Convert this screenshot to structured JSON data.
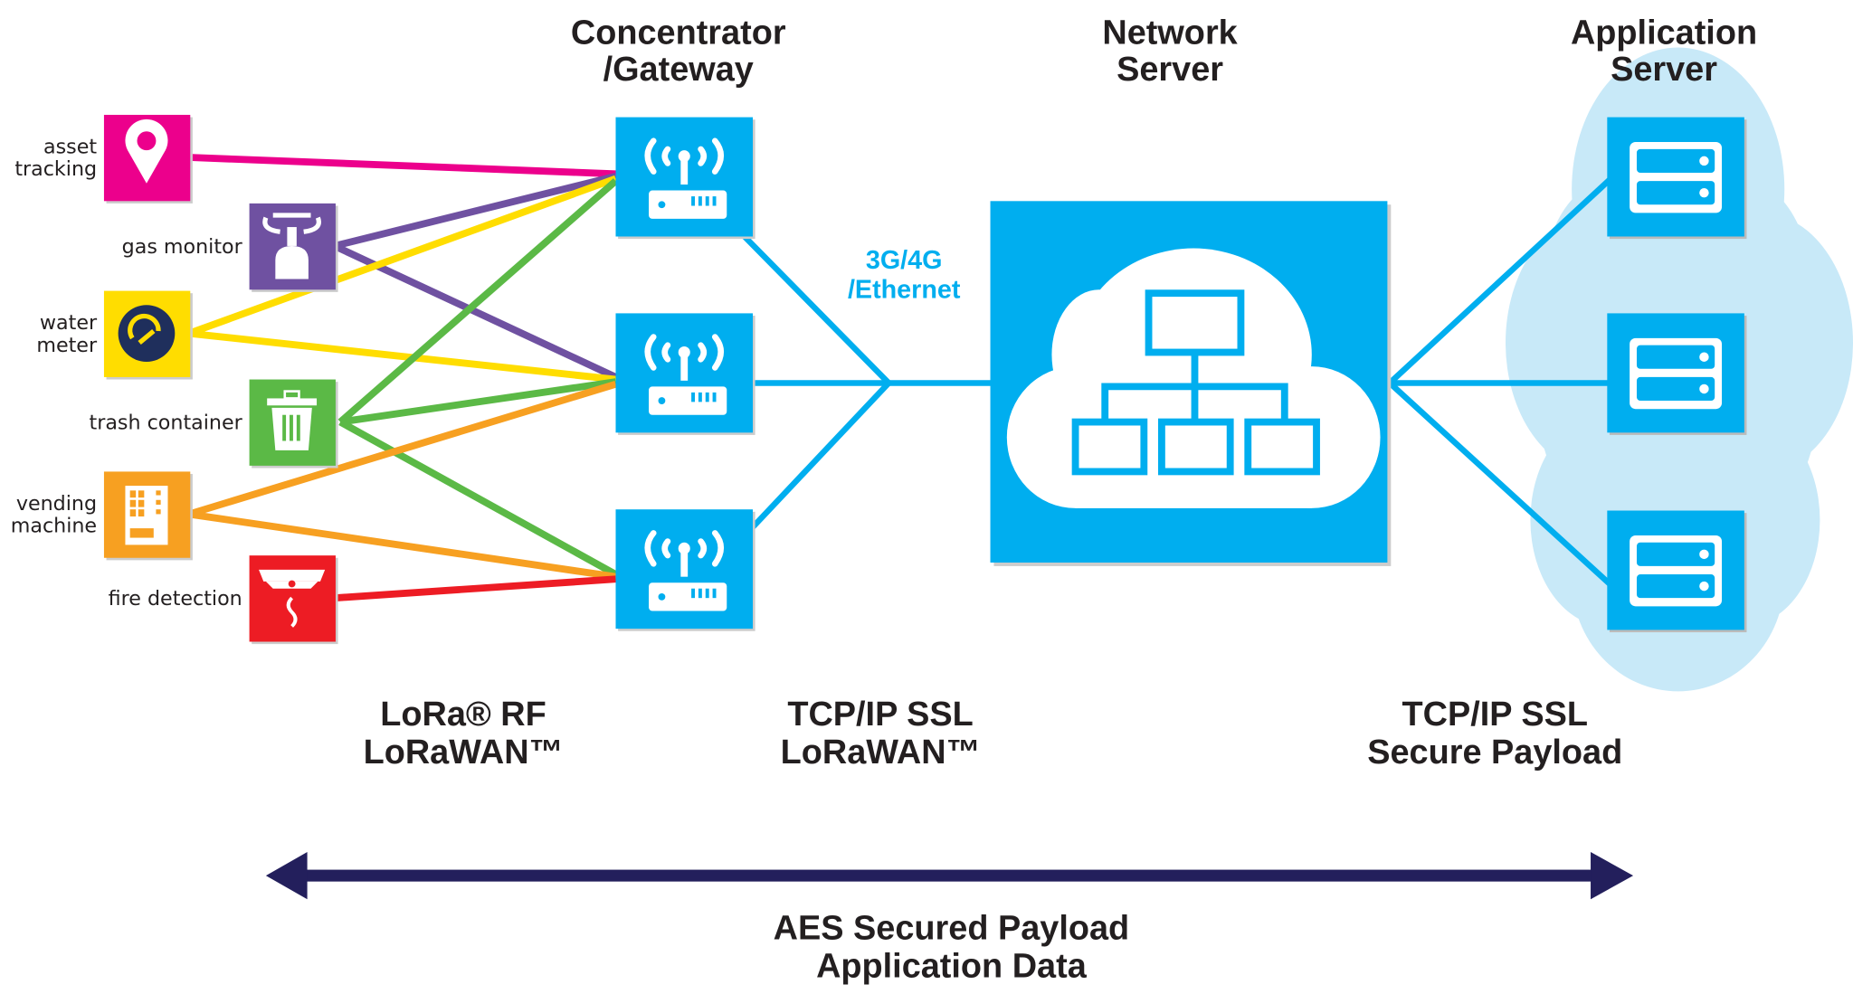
{
  "headers": {
    "gateway": [
      "Concentrator",
      "/Gateway"
    ],
    "network_server": [
      "Network",
      "Server"
    ],
    "application_server": [
      "Application",
      "Server"
    ]
  },
  "backhaul_label": [
    "3G/4G",
    "/Ethernet"
  ],
  "sensors": [
    {
      "label": [
        "asset",
        "tracking"
      ],
      "icon": "map-pin-icon",
      "color": "#ec008c"
    },
    {
      "label": [
        "gas monitor"
      ],
      "icon": "gas-canister-icon",
      "color": "#6f51a1"
    },
    {
      "label": [
        "water",
        "meter"
      ],
      "icon": "gauge-icon",
      "color": "#ffdd00"
    },
    {
      "label": [
        "trash container"
      ],
      "icon": "trash-can-icon",
      "color": "#5bb946"
    },
    {
      "label": [
        "vending",
        "machine"
      ],
      "icon": "vending-machine-icon",
      "color": "#f7a021"
    },
    {
      "label": [
        "fire detection"
      ],
      "icon": "smoke-detector-icon",
      "color": "#ed1c24"
    }
  ],
  "connections": [
    [
      0,
      0
    ],
    [
      1,
      0
    ],
    [
      1,
      1
    ],
    [
      2,
      0
    ],
    [
      2,
      1
    ],
    [
      3,
      0
    ],
    [
      3,
      1
    ],
    [
      3,
      2
    ],
    [
      4,
      1
    ],
    [
      4,
      2
    ],
    [
      5,
      2
    ]
  ],
  "protocols": {
    "sensor_to_gateway": [
      "LoRa® RF",
      "LoRaWAN™"
    ],
    "gateway_to_network": [
      "TCP/IP SSL",
      "LoRaWAN™"
    ],
    "network_to_application": [
      "TCP/IP SSL",
      "Secure Payload"
    ]
  },
  "end_to_end": [
    "AES Secured Payload",
    "Application Data"
  ],
  "colors": {
    "blue": "#00aeef",
    "light_cloud": "#c8e9f8",
    "arrow": "#231f5c",
    "text": "#231f20"
  }
}
